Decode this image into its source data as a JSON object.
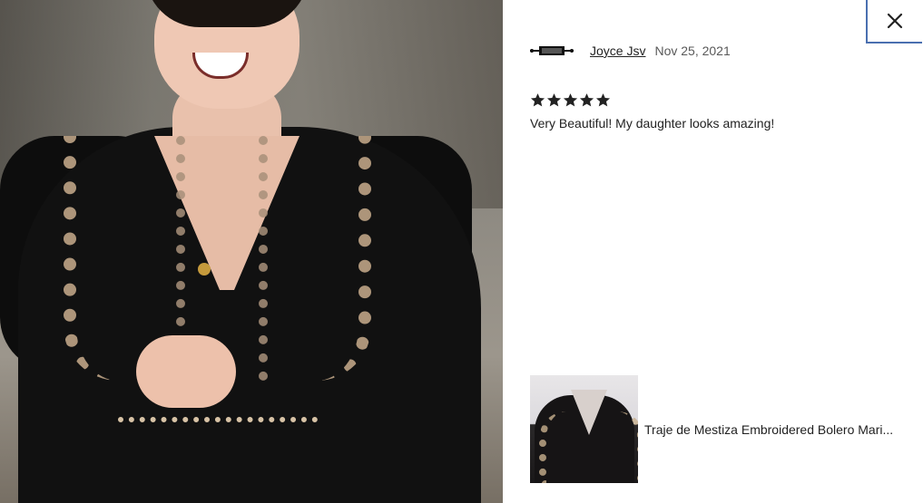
{
  "photo": {
    "alt": "Girl in black dress with embroidered bolero"
  },
  "review": {
    "reviewer": "Joyce Jsv",
    "date": "Nov 25, 2021",
    "rating": 5,
    "rating_max": 5,
    "text": "Very Beautiful! My daughter looks amazing!"
  },
  "item": {
    "title": "Traje de Mestiza Embroidered Bolero Mari..."
  },
  "colors": {
    "close_border": "#4a6fb0",
    "text": "#222222",
    "date": "#595959"
  }
}
